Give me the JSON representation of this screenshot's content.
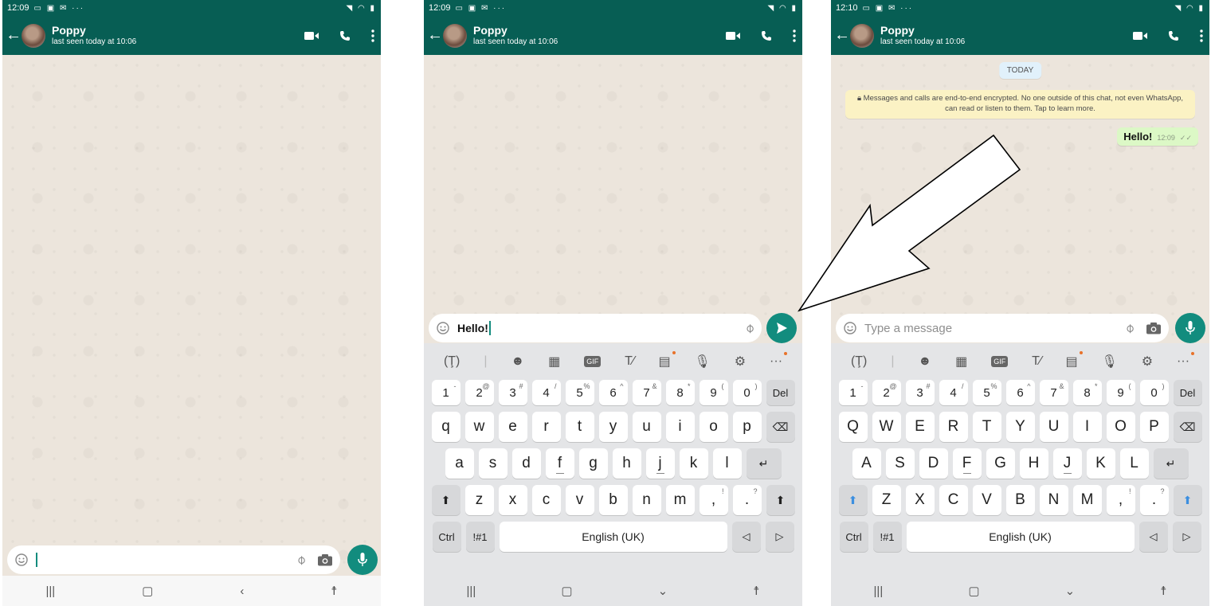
{
  "colors": {
    "header": "#075e54",
    "accent": "#128c7e",
    "chat_bg": "#ece5dc",
    "bubble_out": "#dcf8c6",
    "notice": "#fbf2c4"
  },
  "screen1": {
    "status_time": "12:09",
    "contact_name": "Poppy",
    "last_seen": "last seen today at 10:06"
  },
  "screen2": {
    "status_time": "12:09",
    "contact_name": "Poppy",
    "last_seen": "last seen today at 10:06",
    "input_text": "Hello!"
  },
  "screen3": {
    "status_time": "12:10",
    "contact_name": "Poppy",
    "last_seen": "last seen today at 10:06",
    "date_pill": "TODAY",
    "encryption_notice": "Messages and calls are end-to-end encrypted. No one outside of this chat, not even WhatsApp, can read or listen to them. Tap to learn more.",
    "message_text": "Hello!",
    "message_time": "12:09",
    "input_placeholder": "Type a message"
  },
  "keyboard": {
    "toolbar_icons": [
      "translate-icon",
      "emoji-icon",
      "sticker-icon",
      "gif-icon",
      "text-style-icon",
      "clipboard-icon",
      "mic-icon",
      "settings-icon",
      "more-icon"
    ],
    "gif_label": "GIF",
    "number_row": [
      {
        "k": "1",
        "s": "-"
      },
      {
        "k": "2",
        "s": "@"
      },
      {
        "k": "3",
        "s": "#"
      },
      {
        "k": "4",
        "s": "/"
      },
      {
        "k": "5",
        "s": "%"
      },
      {
        "k": "6",
        "s": "^"
      },
      {
        "k": "7",
        "s": "&"
      },
      {
        "k": "8",
        "s": "*"
      },
      {
        "k": "9",
        "s": "("
      },
      {
        "k": "0",
        "s": ")"
      }
    ],
    "del_label": "Del",
    "row1_lower": [
      "q",
      "w",
      "e",
      "r",
      "t",
      "y",
      "u",
      "i",
      "o",
      "p"
    ],
    "row2_lower": [
      "a",
      "s",
      "d",
      "f",
      "g",
      "h",
      "j",
      "k",
      "l"
    ],
    "row3_lower": [
      "z",
      "x",
      "c",
      "v",
      "b",
      "n",
      "m"
    ],
    "row1_upper": [
      "Q",
      "W",
      "E",
      "R",
      "T",
      "Y",
      "U",
      "I",
      "O",
      "P"
    ],
    "row2_upper": [
      "A",
      "S",
      "D",
      "F",
      "G",
      "H",
      "J",
      "K",
      "L"
    ],
    "row3_upper": [
      "Z",
      "X",
      "C",
      "V",
      "B",
      "N",
      "M"
    ],
    "comma_key": ",",
    "comma_sup": "!",
    "period_key": ".",
    "period_sup": "?",
    "ctrl_label": "Ctrl",
    "symbols_label": "!#1",
    "space_label": "English (UK)"
  }
}
